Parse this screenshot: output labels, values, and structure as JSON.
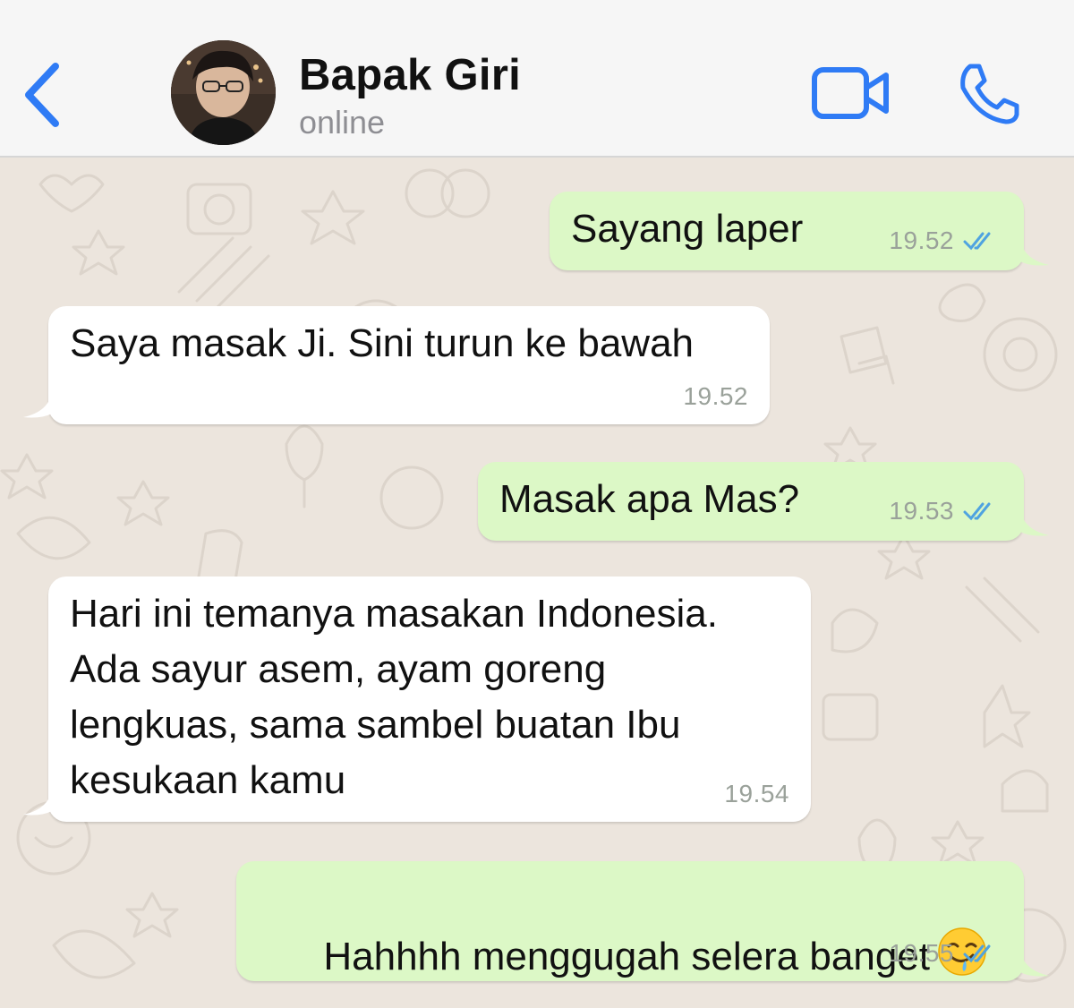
{
  "header": {
    "contact_name": "Bapak Giri",
    "status": "online",
    "back_icon": "chevron-left-icon",
    "video_icon": "video-camera-icon",
    "call_icon": "phone-icon",
    "accent_color": "#2f7bf5"
  },
  "messages": [
    {
      "direction": "outgoing",
      "text": "Sayang laper",
      "time": "19.52",
      "status": "read"
    },
    {
      "direction": "incoming",
      "text": "Saya masak Ji. Sini turun ke bawah",
      "time": "19.52"
    },
    {
      "direction": "outgoing",
      "text": "Masak apa Mas?",
      "time": "19.53",
      "status": "read"
    },
    {
      "direction": "incoming",
      "lines": [
        "Hari ini temanya masakan Indonesia.",
        "Ada sayur asem, ayam goreng",
        "lengkuas, sama sambel buatan Ibu",
        "kesukaan kamu"
      ],
      "time": "19.54"
    },
    {
      "direction": "outgoing",
      "text": "Hahhhh menggugah selera banget",
      "emoji": "drooling-face-emoji",
      "time": "19.55",
      "status": "read"
    }
  ],
  "colors": {
    "outgoing_bubble": "#dcf8c6",
    "incoming_bubble": "#ffffff",
    "read_ticks": "#4fa3e0",
    "wallpaper": "#ece5dd"
  }
}
